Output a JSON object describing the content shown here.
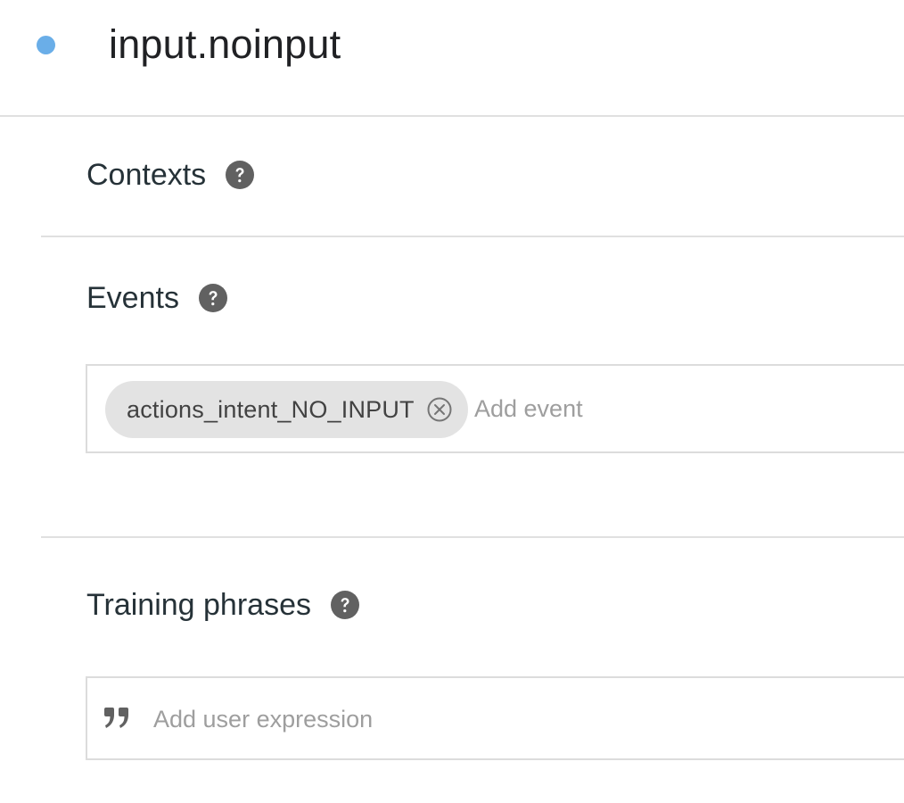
{
  "intent": {
    "title": "input.noinput",
    "status_dot_color": "#6aaee8"
  },
  "sections": {
    "contexts": {
      "title": "Contexts",
      "help_icon": "help-circle-icon"
    },
    "events": {
      "title": "Events",
      "help_icon": "help-circle-icon",
      "chips": [
        {
          "label": "actions_intent_NO_INPUT",
          "remove_icon": "close-circle-icon"
        }
      ],
      "input_placeholder": "Add event"
    },
    "training_phrases": {
      "title": "Training phrases",
      "help_icon": "help-circle-icon",
      "quote_icon": "quote-icon",
      "input_placeholder": "Add user expression"
    }
  }
}
